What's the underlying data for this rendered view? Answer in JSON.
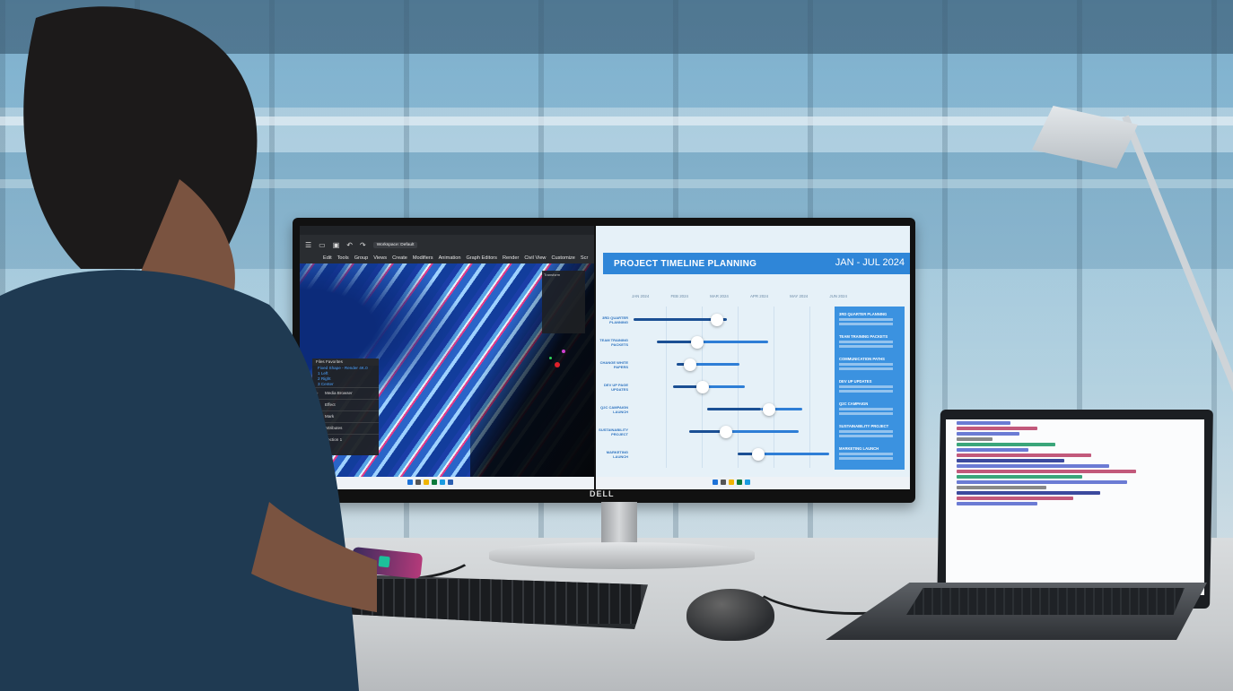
{
  "scene": "Person at a desk using a curved Dell monitor with split screen, a laptop with code, keyboard, mouse and phone",
  "brand": "DELL",
  "left_app": {
    "workspace_label": "Workspace: Default",
    "menu": [
      "Edit",
      "Tools",
      "Group",
      "Views",
      "Create",
      "Modifiers",
      "Animation",
      "Graph Editors",
      "Render",
      "Civil View",
      "Customize",
      "Scr"
    ],
    "transform_panel_title": "Transform",
    "scene_panel": {
      "header": [
        "Files",
        "Favorites"
      ],
      "items": [
        "Fixed Shape - Render 4K.0",
        "1 Left",
        "2 Right",
        "3 Center"
      ],
      "sections": [
        "Media Browser",
        "Effect",
        "Mark",
        "Attributes",
        "Section 1"
      ]
    }
  },
  "right_app": {
    "title": "PROJECT TIMELINE PLANNING",
    "date_range": "JAN - JUL 2024",
    "months": [
      "JAN 2024",
      "FEB 2024",
      "MAR 2024",
      "APR 2024",
      "MAY 2024",
      "JUN 2024"
    ],
    "rows": [
      {
        "label": "3RD QUARTER PLANNING"
      },
      {
        "label": "TEAM TRAINING PACKETS"
      },
      {
        "label": "CHANGE WHITE PAPERS"
      },
      {
        "label": "DEV UP PAGE UPDATES"
      },
      {
        "label": "Q2C CAMPAIGN LAUNCH"
      },
      {
        "label": "SUSTAINABILITY PROJECT"
      },
      {
        "label": "MARKETING LAUNCH"
      }
    ],
    "side_entries": [
      "3RD QUARTER PLANNING",
      "TEAM TRAINING PACKETS",
      "COMMUNICATION PATHS",
      "DEV UP UPDATES",
      "Q2C CAMPAIGN",
      "SUSTAINABILITY PROJECT",
      "MARKETING LAUNCH"
    ]
  },
  "colors": {
    "accent": "#2f86d8",
    "bar_dark": "#1a4f94",
    "panel": "#3b92e0"
  }
}
